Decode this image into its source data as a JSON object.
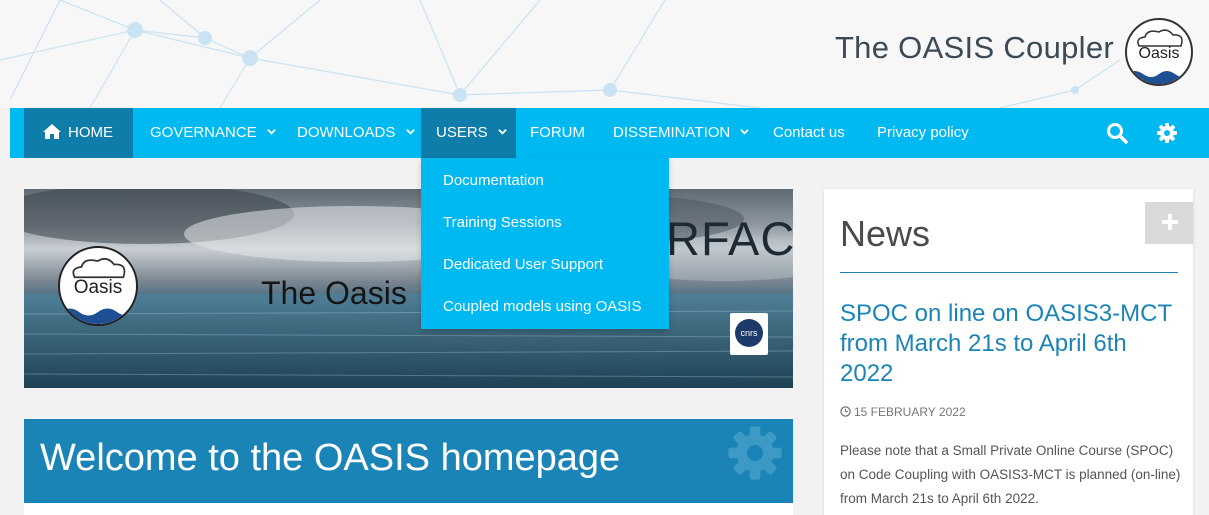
{
  "header": {
    "site_title": "The OASIS Coupler",
    "logo_text": "Oasis"
  },
  "nav": {
    "items": [
      {
        "label": "HOME",
        "icon": "home-icon",
        "active": false
      },
      {
        "label": "GOVERNANCE",
        "dropdown": true
      },
      {
        "label": "DOWNLOADS",
        "dropdown": true
      },
      {
        "label": "USERS",
        "dropdown": true,
        "active": true
      },
      {
        "label": "FORUM"
      },
      {
        "label": "DISSEMINATION",
        "dropdown": true
      },
      {
        "label": "Contact us"
      },
      {
        "label": "Privacy policy"
      }
    ],
    "search_icon": "search-icon",
    "settings_icon": "gear-icon"
  },
  "users_menu": {
    "items": [
      "Documentation",
      "Training Sessions",
      "Dedicated User Support",
      "Coupled models using OASIS"
    ]
  },
  "hero": {
    "title": "The Oasis",
    "rfacs": "RFACS",
    "logo_text": "Oasis",
    "cnrs_text": "cnrs"
  },
  "welcome": {
    "title": "Welcome to the OASIS homepage"
  },
  "news": {
    "heading": "News",
    "article_title": "SPOC on line on OASIS3-MCT from March 21s to April 6th 2022",
    "date": "15 FEBRUARY 2022",
    "body": "Please note that a Small Private Online Course (SPOC) on Code Coupling with OASIS3-MCT is planned (on-line) from March 21s to April 6th 2022."
  },
  "colors": {
    "nav_bg": "#00b9f1",
    "nav_active": "#0f7da9",
    "accent": "#1a84b7",
    "page_bg": "#f2f2f2"
  }
}
